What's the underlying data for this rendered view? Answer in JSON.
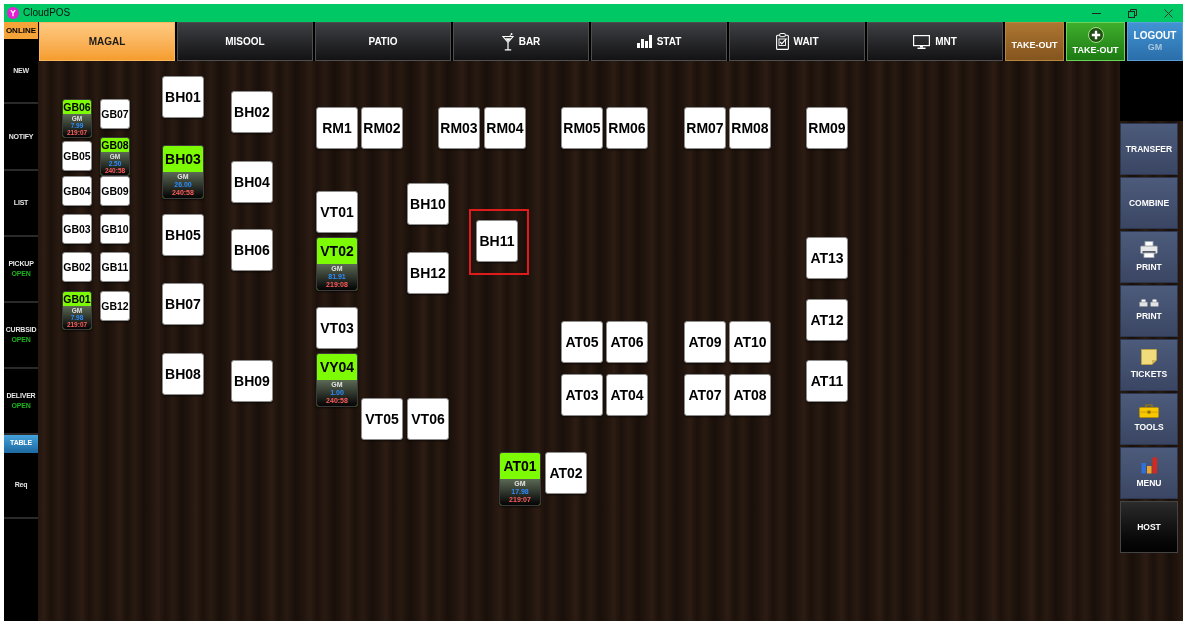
{
  "window": {
    "title": "CloudPOS"
  },
  "connection": {
    "label": "ONLINE"
  },
  "tabs": [
    {
      "label": "MAGAL",
      "selected": true
    },
    {
      "label": "MISOOL",
      "selected": false
    },
    {
      "label": "PATIO",
      "selected": false
    },
    {
      "label": "BAR",
      "selected": false
    },
    {
      "label": "STAT",
      "selected": false
    },
    {
      "label": "WAIT",
      "selected": false
    },
    {
      "label": "MNT",
      "selected": false
    }
  ],
  "order_buttons": [
    {
      "label": "TAKE-OUT",
      "kind": "orders"
    },
    {
      "label": "TAKE-OUT",
      "kind": "new"
    }
  ],
  "logout": {
    "label": "LOGOUT",
    "user": "GM"
  },
  "sidebar": {
    "items": [
      {
        "label": "NEW",
        "selected": false
      },
      {
        "label": "NOTIFY",
        "selected": false
      },
      {
        "label": "LIST",
        "selected": false
      },
      {
        "label": "PICKUP",
        "status": "OPEN",
        "selected": false
      },
      {
        "label": "CURBSID",
        "status": "OPEN",
        "selected": false
      },
      {
        "label": "DELIVER",
        "status": "OPEN",
        "selected": false
      },
      {
        "label": "TABLE",
        "selected": true
      },
      {
        "label": "Req",
        "selected": false
      }
    ]
  },
  "floor": {
    "tables": [
      {
        "label": "GB06",
        "occupied": true,
        "selected": false,
        "server": "GM",
        "amount": "7.99",
        "elapsed": "219:07"
      },
      {
        "label": "GB07",
        "occupied": false,
        "selected": false
      },
      {
        "label": "GB05",
        "occupied": false,
        "selected": false
      },
      {
        "label": "GB08",
        "occupied": true,
        "selected": false,
        "server": "GM",
        "amount": "2.50",
        "elapsed": "240:58"
      },
      {
        "label": "GB04",
        "occupied": false,
        "selected": false
      },
      {
        "label": "GB09",
        "occupied": false,
        "selected": false
      },
      {
        "label": "GB03",
        "occupied": false,
        "selected": false
      },
      {
        "label": "GB10",
        "occupied": false,
        "selected": false
      },
      {
        "label": "GB02",
        "occupied": false,
        "selected": false
      },
      {
        "label": "GB11",
        "occupied": false,
        "selected": false
      },
      {
        "label": "GB01",
        "occupied": true,
        "selected": false,
        "server": "GM",
        "amount": "7.98",
        "elapsed": "219:07"
      },
      {
        "label": "GB12",
        "occupied": false,
        "selected": false
      },
      {
        "label": "BH01",
        "occupied": false,
        "selected": false
      },
      {
        "label": "BH02",
        "occupied": false,
        "selected": false
      },
      {
        "label": "BH03",
        "occupied": true,
        "selected": false,
        "server": "GM",
        "amount": "26.00",
        "elapsed": "240:58"
      },
      {
        "label": "BH04",
        "occupied": false,
        "selected": false
      },
      {
        "label": "BH05",
        "occupied": false,
        "selected": false
      },
      {
        "label": "BH06",
        "occupied": false,
        "selected": false
      },
      {
        "label": "BH07",
        "occupied": false,
        "selected": false
      },
      {
        "label": "BH08",
        "occupied": false,
        "selected": false
      },
      {
        "label": "BH09",
        "occupied": false,
        "selected": false
      },
      {
        "label": "RM1",
        "occupied": false,
        "selected": false
      },
      {
        "label": "RM02",
        "occupied": false,
        "selected": false
      },
      {
        "label": "RM03",
        "occupied": false,
        "selected": false
      },
      {
        "label": "RM04",
        "occupied": false,
        "selected": false
      },
      {
        "label": "RM05",
        "occupied": false,
        "selected": false
      },
      {
        "label": "RM06",
        "occupied": false,
        "selected": false
      },
      {
        "label": "RM07",
        "occupied": false,
        "selected": false
      },
      {
        "label": "RM08",
        "occupied": false,
        "selected": false
      },
      {
        "label": "RM09",
        "occupied": false,
        "selected": false
      },
      {
        "label": "VT01",
        "occupied": false,
        "selected": false
      },
      {
        "label": "VT02",
        "occupied": true,
        "selected": false,
        "server": "GM",
        "amount": "81.91",
        "elapsed": "219:08"
      },
      {
        "label": "VT03",
        "occupied": false,
        "selected": false
      },
      {
        "label": "VY04",
        "occupied": true,
        "selected": false,
        "server": "GM",
        "amount": "1.00",
        "elapsed": "240:58"
      },
      {
        "label": "BH10",
        "occupied": false,
        "selected": false
      },
      {
        "label": "BH11",
        "occupied": false,
        "selected": true
      },
      {
        "label": "BH12",
        "occupied": false,
        "selected": false
      },
      {
        "label": "VT05",
        "occupied": false,
        "selected": false
      },
      {
        "label": "VT06",
        "occupied": false,
        "selected": false
      },
      {
        "label": "AT13",
        "occupied": false,
        "selected": false
      },
      {
        "label": "AT12",
        "occupied": false,
        "selected": false
      },
      {
        "label": "AT11",
        "occupied": false,
        "selected": false
      },
      {
        "label": "AT05",
        "occupied": false,
        "selected": false
      },
      {
        "label": "AT06",
        "occupied": false,
        "selected": false
      },
      {
        "label": "AT09",
        "occupied": false,
        "selected": false
      },
      {
        "label": "AT10",
        "occupied": false,
        "selected": false
      },
      {
        "label": "AT03",
        "occupied": false,
        "selected": false
      },
      {
        "label": "AT04",
        "occupied": false,
        "selected": false
      },
      {
        "label": "AT07",
        "occupied": false,
        "selected": false
      },
      {
        "label": "AT08",
        "occupied": false,
        "selected": false
      },
      {
        "label": "AT01",
        "occupied": true,
        "selected": false,
        "server": "GM",
        "amount": "17.98",
        "elapsed": "219:07"
      },
      {
        "label": "AT02",
        "occupied": false,
        "selected": false
      }
    ]
  },
  "actions": [
    {
      "label": "TRANSFER",
      "kind": "function"
    },
    {
      "label": "COMBINE",
      "kind": "function"
    },
    {
      "label": "PRINT",
      "kind": "function"
    },
    {
      "label": "PRINT",
      "kind": "function"
    },
    {
      "label": "TICKETS",
      "kind": "function"
    },
    {
      "label": "TOOLS",
      "kind": "function"
    },
    {
      "label": "MENU",
      "kind": "function"
    },
    {
      "label": "HOST",
      "kind": "host"
    }
  ]
}
